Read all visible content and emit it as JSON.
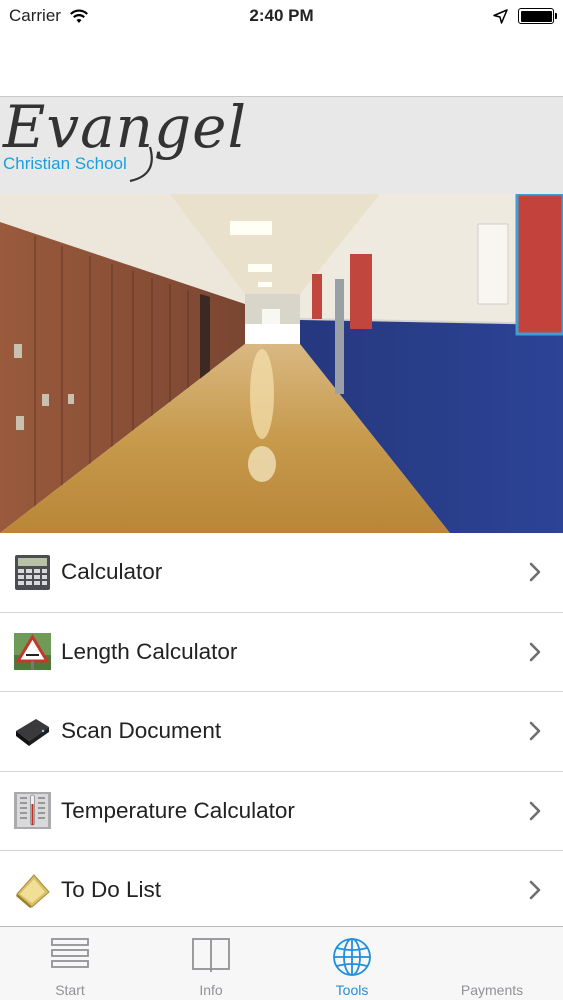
{
  "status_bar": {
    "carrier": "Carrier",
    "time": "2:40 PM"
  },
  "header": {
    "logo_main": "Evangel",
    "logo_sub": "Christian School"
  },
  "tools": [
    {
      "label": "Calculator",
      "icon": "calculator-icon"
    },
    {
      "label": "Length Calculator",
      "icon": "ruler-sign-icon"
    },
    {
      "label": "Scan Document",
      "icon": "scanner-icon"
    },
    {
      "label": "Temperature Calculator",
      "icon": "thermometer-icon"
    },
    {
      "label": "To Do List",
      "icon": "note-icon"
    }
  ],
  "tabbar": {
    "tabs": [
      {
        "label": "Start",
        "icon": "list-icon"
      },
      {
        "label": "Info",
        "icon": "book-icon"
      },
      {
        "label": "Tools",
        "icon": "globe-icon",
        "active": true
      },
      {
        "label": "Payments",
        "icon": "payments-icon"
      }
    ]
  },
  "colors": {
    "accent": "#1f8fe0",
    "logo_sub": "#1a9fdc",
    "header_bg": "#e8e8e9"
  }
}
